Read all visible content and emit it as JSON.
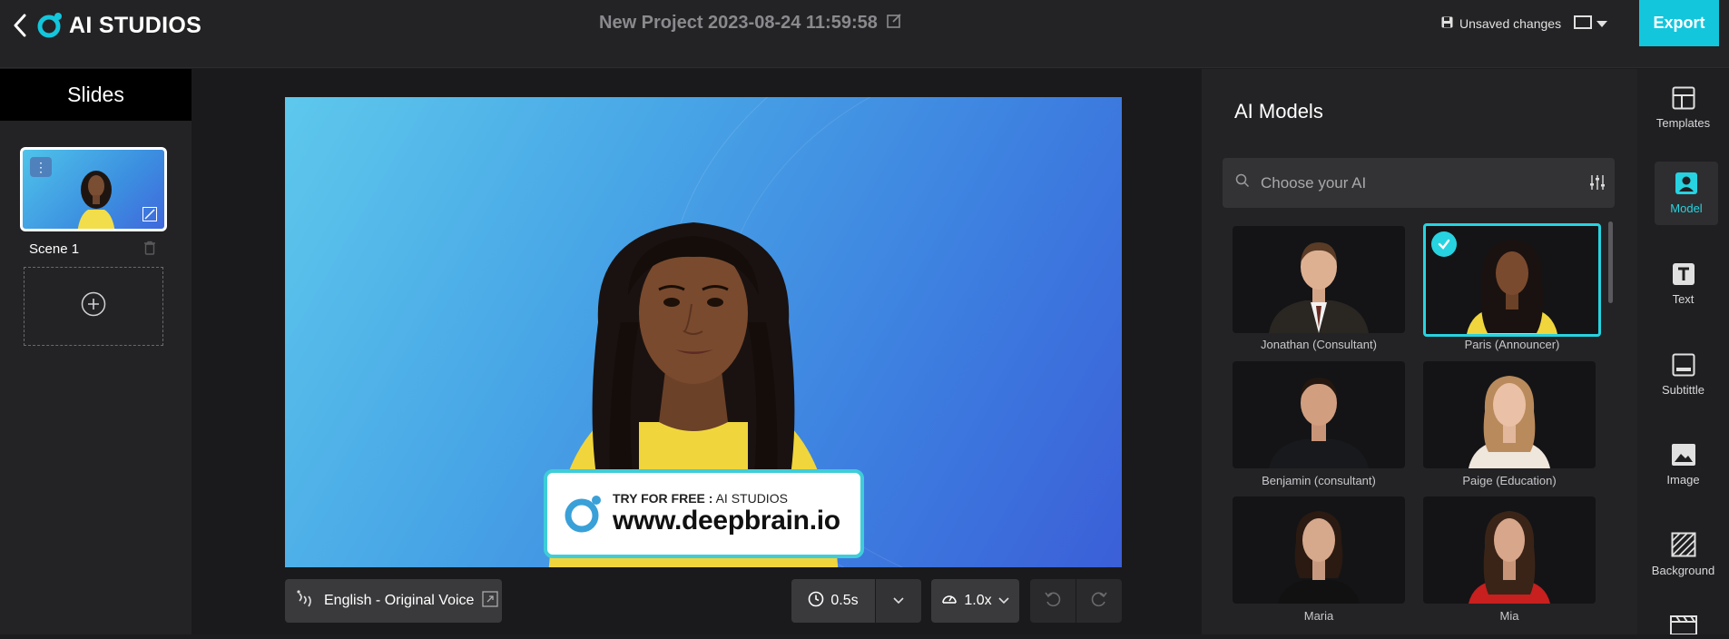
{
  "header": {
    "logo_text": "AI STUDIOS",
    "project_title": "New Project 2023-08-24 11:59:58",
    "unsaved_label": "Unsaved changes",
    "export_label": "Export",
    "accent_color": "#13c6dc"
  },
  "slides": {
    "title": "Slides",
    "items": [
      {
        "label": "Scene 1"
      }
    ]
  },
  "canvas": {
    "banner_small_prefix": "TRY FOR FREE :",
    "banner_small_suffix": "AI STUDIOS",
    "banner_url": "www.deepbrain.io"
  },
  "controls": {
    "voice_label": "English - Original Voice",
    "pause_label": "0.5s",
    "speed_label": "1.0x"
  },
  "models": {
    "title": "AI Models",
    "search_placeholder": "Choose your AI",
    "items": [
      {
        "name": "Jonathan (Consultant)",
        "selected": false
      },
      {
        "name": "Paris (Announcer)",
        "selected": true
      },
      {
        "name": "Benjamin (consultant)",
        "selected": false
      },
      {
        "name": "Paige (Education)",
        "selected": false
      },
      {
        "name": "Maria",
        "selected": false
      },
      {
        "name": "Mia",
        "selected": false
      }
    ]
  },
  "rail": {
    "items": [
      {
        "label": "Templates",
        "icon": "templates-icon"
      },
      {
        "label": "Model",
        "icon": "model-icon",
        "active": true
      },
      {
        "label": "Text",
        "icon": "text-icon"
      },
      {
        "label": "Subtittle",
        "icon": "subtitle-icon"
      },
      {
        "label": "Image",
        "icon": "image-icon"
      },
      {
        "label": "Background",
        "icon": "background-icon"
      }
    ]
  }
}
